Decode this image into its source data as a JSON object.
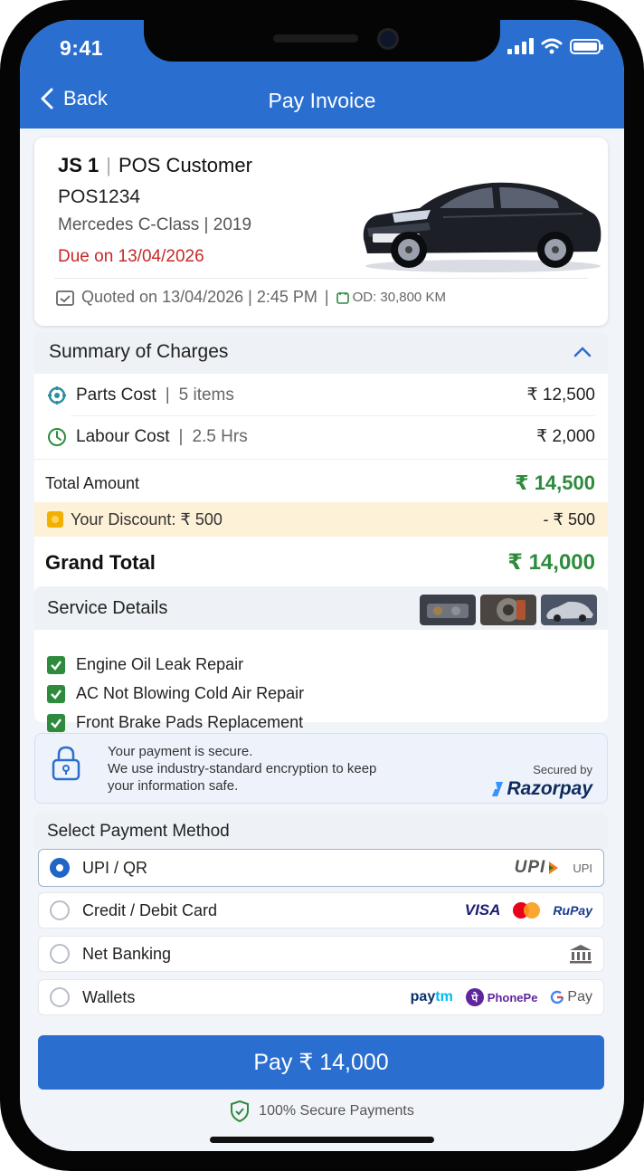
{
  "status_bar": {
    "time": "9:41"
  },
  "nav": {
    "back_label": "Back",
    "title": "Pay Invoice"
  },
  "invoice": {
    "job_id": "JS 1",
    "customer": "POS Customer",
    "vehicle_number": "POS1234",
    "model": "Mercedes C-Class",
    "year": "2019",
    "due": "Due on 13/04/2026",
    "quoted": "Quoted on 13/04/2026 | 2:45 PM",
    "odometer": "OD: 30,800 KM"
  },
  "summary": {
    "title": "Summary of Charges",
    "parts": {
      "label": "Parts Cost",
      "detail": "5 items",
      "amount": "₹ 12,500"
    },
    "labour": {
      "label": "Labour Cost",
      "detail": "2.5 Hrs",
      "amount": "₹ 2,000"
    },
    "total": {
      "label": "Total Amount",
      "amount": "₹ 14,500"
    },
    "discount": {
      "label": "Your Discount: ₹ 500",
      "amount": "- ₹ 500"
    },
    "grand": {
      "label": "Grand Total",
      "amount": "₹ 14,000"
    }
  },
  "service": {
    "title": "Service Details",
    "items": [
      "Engine Oil Leak Repair",
      "AC Not Blowing Cold Air Repair",
      "Front Brake Pads Replacement"
    ]
  },
  "security": {
    "line1": "Your payment is secure.",
    "line2": "We use industry-standard encryption to keep",
    "line3": "your information safe.",
    "secured_by": "Secured by",
    "provider": "Razorpay"
  },
  "payment": {
    "title": "Select Payment Method",
    "options": [
      {
        "label": "UPI / QR",
        "selected": true
      },
      {
        "label": "Credit / Debit Card",
        "selected": false
      },
      {
        "label": "Net Banking",
        "selected": false
      },
      {
        "label": "Wallets",
        "selected": false
      }
    ],
    "logos": {
      "upi_mark": "UPI",
      "upi_text": "UPI",
      "visa": "VISA",
      "rupay": "RuPay",
      "paytm_a": "pay",
      "paytm_b": "tm",
      "phonepe": "PhonePe",
      "gpay": "Pay"
    }
  },
  "pay_button": "Pay ₹ 14,000",
  "footer": "100% Secure Payments",
  "colors": {
    "primary": "#2a6fd0",
    "green": "#2e8b3e",
    "due_red": "#c62828",
    "discount_bg": "#fdf1d8"
  }
}
